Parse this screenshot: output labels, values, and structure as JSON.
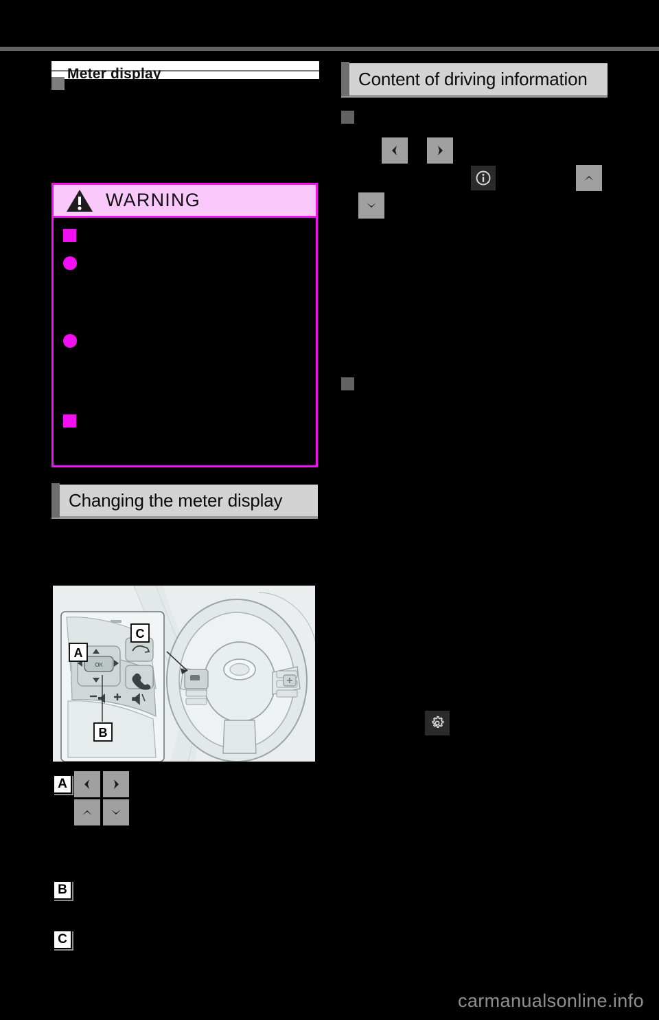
{
  "page": {
    "background_color": "#000000",
    "watermark": "carmanualsonline.info"
  },
  "left_column": {
    "cropped_heading": "Meter display",
    "warning": {
      "title": "WARNING",
      "icon": "warning-triangle-icon",
      "header_bg": "#fbc8fb",
      "border_color": "#f20ff2",
      "items": [
        {
          "marker": "square",
          "text": ""
        },
        {
          "marker": "circle",
          "text": ""
        },
        {
          "marker": "circle",
          "text": ""
        },
        {
          "marker": "square",
          "text": ""
        }
      ]
    },
    "section_heading": "Changing the meter display",
    "illustration": {
      "name": "steering-wheel-switches-illustration",
      "callouts": [
        "A",
        "B",
        "C"
      ]
    },
    "callout_a": {
      "label": "A",
      "buttons": [
        {
          "icon": "chevron-left-icon",
          "glyph": "<"
        },
        {
          "icon": "chevron-right-icon",
          "glyph": ">"
        },
        {
          "icon": "chevron-up-icon",
          "glyph": "^"
        },
        {
          "icon": "chevron-down-icon",
          "glyph": "v"
        }
      ]
    },
    "callout_b": {
      "label": "B"
    },
    "callout_c": {
      "label": "C"
    }
  },
  "right_column": {
    "section_title": "Content of driving information",
    "subsection_1": {
      "marker": "square",
      "buttons": [
        {
          "icon": "chevron-left-icon",
          "glyph": "<"
        },
        {
          "icon": "chevron-right-icon",
          "glyph": ">"
        },
        {
          "icon": "info-icon",
          "glyph": "i"
        },
        {
          "icon": "chevron-up-icon",
          "glyph": "^"
        },
        {
          "icon": "chevron-down-icon",
          "glyph": "v"
        }
      ]
    },
    "subsection_2": {
      "marker": "square",
      "icons": [
        {
          "icon": "gear-settings-icon"
        }
      ]
    }
  },
  "colors": {
    "page_bg": "#000000",
    "rule": "#636363",
    "bar_head_bg": "#d3d3d3",
    "bar_head_tab": "#6e6e6e",
    "bar_head_shadow": "#9a9a9a",
    "marker_gray": "#7d7d7d",
    "magenta": "#f20ff2",
    "magenta_light": "#fbc8fb",
    "key_gray": "#a0a0a0",
    "dark_tile": "#2b2b2b",
    "watermark": "#8f8f8f"
  }
}
